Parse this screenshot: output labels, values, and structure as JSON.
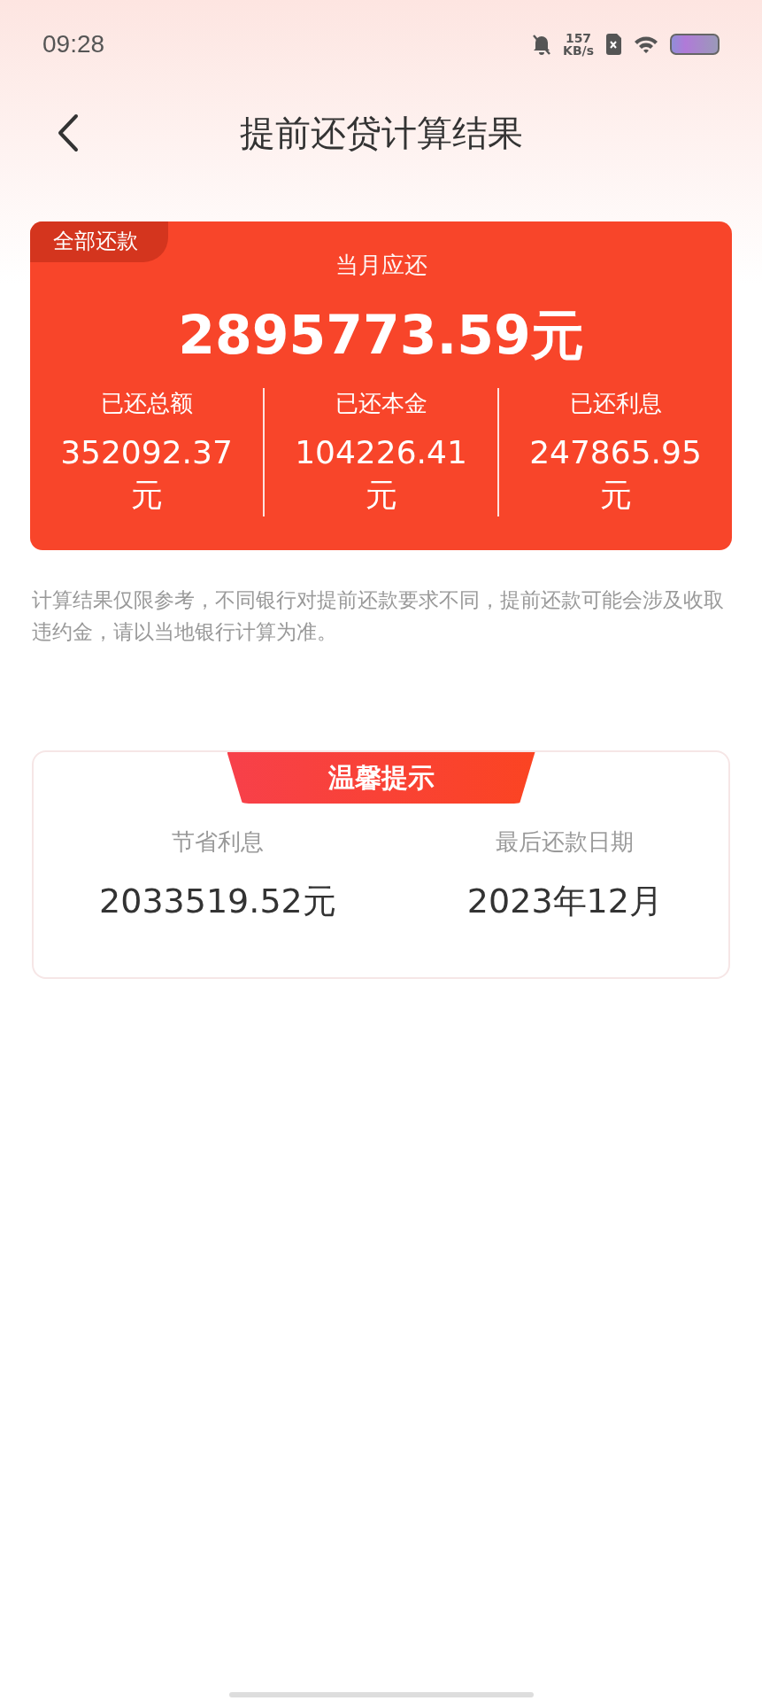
{
  "status_bar": {
    "time": "09:28",
    "net_speed": "157",
    "net_unit": "KB/s"
  },
  "header": {
    "title": "提前还贷计算结果"
  },
  "result_card": {
    "badge": "全部还款",
    "label": "当月应还",
    "amount": "2895773.59元",
    "stats": [
      {
        "label": "已还总额",
        "value": "352092.37",
        "unit": "元"
      },
      {
        "label": "已还本金",
        "value": "104226.41",
        "unit": "元"
      },
      {
        "label": "已还利息",
        "value": "247865.95",
        "unit": "元"
      }
    ]
  },
  "note": "计算结果仅限参考，不同银行对提前还款要求不同，提前还款可能会涉及收取违约金，请以当地银行计算为准。",
  "tip_card": {
    "title": "温馨提示",
    "items": [
      {
        "label": "节省利息",
        "value": "2033519.52元"
      },
      {
        "label": "最后还款日期",
        "value": "2023年12月"
      }
    ]
  }
}
